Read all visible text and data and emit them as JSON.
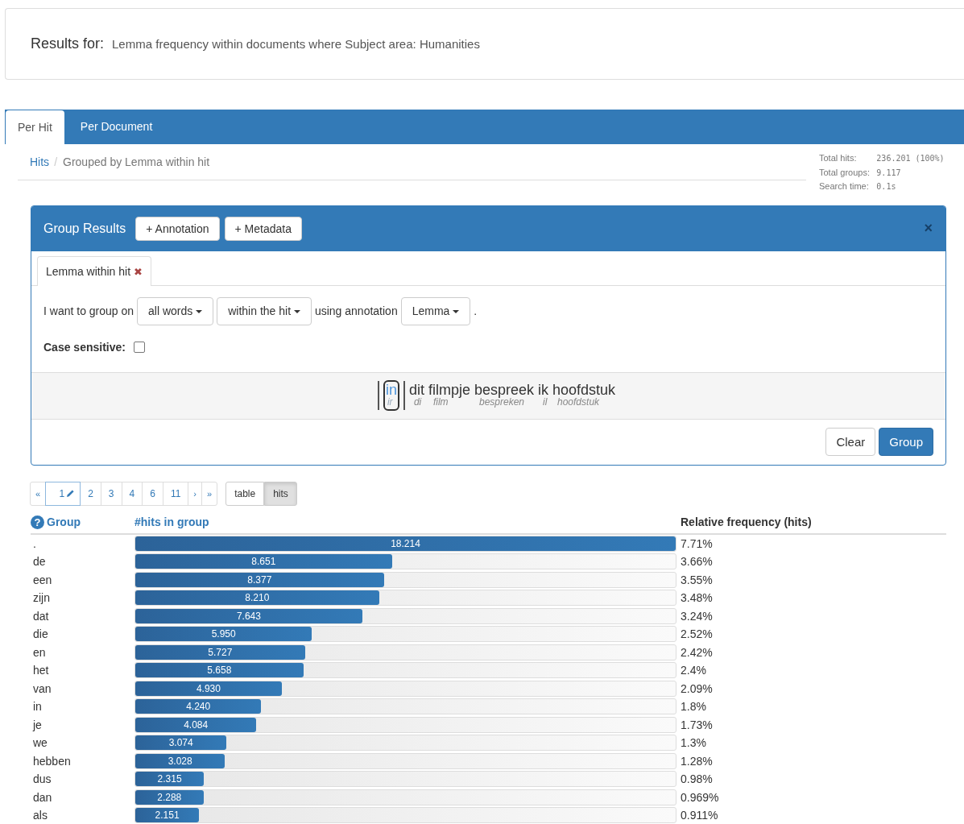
{
  "results_header": {
    "label": "Results for:",
    "query": "Lemma frequency within documents where Subject area: Humanities"
  },
  "tabs": [
    {
      "label": "Per Hit",
      "selected": true
    },
    {
      "label": "Per Document",
      "selected": false
    }
  ],
  "breadcrumb": [
    {
      "label": "Hits",
      "kind": "link"
    },
    {
      "label": "/",
      "kind": "separator"
    },
    {
      "label": "Grouped by Lemma within hit",
      "kind": "current"
    }
  ],
  "stats": [
    {
      "label": "Total hits:",
      "value": "236.201 (100%)"
    },
    {
      "label": "Total groups:",
      "value": "9.117"
    },
    {
      "label": "Search time:",
      "value": "0.1s"
    }
  ],
  "group_panel": {
    "title": "Group Results",
    "buttons": [
      "+ Annotation",
      "+ Metadata"
    ],
    "close": "×",
    "criteria_tabs": [
      {
        "label": "Lemma within hit",
        "remove": "✖",
        "selected": true
      }
    ],
    "sentence": [
      {
        "text": "I want to group on",
        "kind": "text"
      },
      {
        "text": "all words",
        "kind": "dropdown"
      },
      {
        "text": "within the hit",
        "kind": "dropdown"
      },
      {
        "text": "using annotation",
        "kind": "text"
      },
      {
        "text": "Lemma",
        "kind": "dropdown"
      },
      {
        "text": ".",
        "kind": "text"
      }
    ],
    "case_sensitive": {
      "label": "Case sensitive:",
      "checked": false
    },
    "preview": [
      {
        "word": "in",
        "lemma": "ir",
        "selected": true
      },
      {
        "word": "dit",
        "lemma": "di",
        "selected": false
      },
      {
        "word": "filmpje",
        "lemma": "film",
        "selected": false
      },
      {
        "word": "bespreek",
        "lemma": "bespreken",
        "selected": false
      },
      {
        "word": "ik",
        "lemma": "il",
        "selected": false
      },
      {
        "word": "hoofdstuk",
        "lemma": "hoofdstuk",
        "selected": false
      }
    ],
    "actions": [
      {
        "label": "Clear",
        "kind": "default"
      },
      {
        "label": "Group",
        "kind": "primary"
      }
    ]
  },
  "pagination": [
    {
      "label": "«",
      "kind": "nav",
      "selected": false
    },
    {
      "label": "1",
      "kind": "edit",
      "selected": true
    },
    {
      "label": "2",
      "kind": "page",
      "selected": false
    },
    {
      "label": "3",
      "kind": "page",
      "selected": false
    },
    {
      "label": "4",
      "kind": "page",
      "selected": false
    },
    {
      "label": "6",
      "kind": "page",
      "selected": false
    },
    {
      "label": "11",
      "kind": "page",
      "selected": false
    },
    {
      "label": "›",
      "kind": "nav",
      "selected": false
    },
    {
      "label": "»",
      "kind": "nav",
      "selected": false
    }
  ],
  "view_toggle": [
    {
      "label": "table",
      "selected": false
    },
    {
      "label": "hits",
      "selected": true
    }
  ],
  "table": {
    "help": "?",
    "columns": [
      "Group",
      "#hits in group",
      "Relative frequency (hits)"
    ],
    "rows": [
      {
        "group": ".",
        "hits": "18.214",
        "level": 1,
        "relative": "7.71%"
      },
      {
        "group": "de",
        "hits": "8.651",
        "level": 0.475,
        "relative": "3.66%"
      },
      {
        "group": "een",
        "hits": "8.377",
        "level": 0.46,
        "relative": "3.55%"
      },
      {
        "group": "zijn",
        "hits": "8.210",
        "level": 0.451,
        "relative": "3.48%"
      },
      {
        "group": "dat",
        "hits": "7.643",
        "level": 0.42,
        "relative": "3.24%"
      },
      {
        "group": "die",
        "hits": "5.950",
        "level": 0.327,
        "relative": "2.52%"
      },
      {
        "group": "en",
        "hits": "5.727",
        "level": 0.314,
        "relative": "2.42%"
      },
      {
        "group": "het",
        "hits": "5.658",
        "level": 0.311,
        "relative": "2.4%"
      },
      {
        "group": "van",
        "hits": "4.930",
        "level": 0.271,
        "relative": "2.09%"
      },
      {
        "group": "in",
        "hits": "4.240",
        "level": 0.233,
        "relative": "1.8%"
      },
      {
        "group": "je",
        "hits": "4.084",
        "level": 0.224,
        "relative": "1.73%"
      },
      {
        "group": "we",
        "hits": "3.074",
        "level": 0.169,
        "relative": "1.3%"
      },
      {
        "group": "hebben",
        "hits": "3.028",
        "level": 0.166,
        "relative": "1.28%"
      },
      {
        "group": "dus",
        "hits": "2.315",
        "level": 0.127,
        "relative": "0.98%"
      },
      {
        "group": "dan",
        "hits": "2.288",
        "level": 0.126,
        "relative": "0.969%"
      },
      {
        "group": "als",
        "hits": "2.151",
        "level": 0.118,
        "relative": "0.911%"
      }
    ]
  }
}
